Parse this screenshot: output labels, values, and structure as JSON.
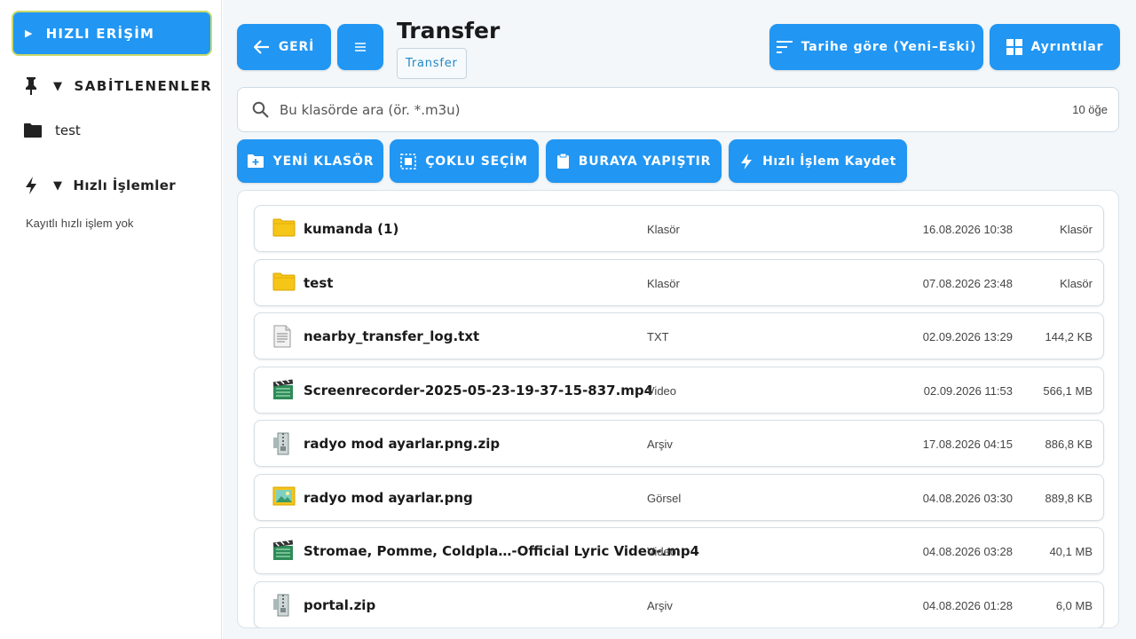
{
  "sidebar": {
    "quick_access_label": "HIZLI ERİŞİM",
    "pinned_label": "SABİTLENENLER",
    "pinned_items": [
      "test"
    ],
    "quick_ops_label": "Hızlı İşlemler",
    "quick_ops_empty": "Kayıtlı hızlı işlem yok"
  },
  "header": {
    "back_label": "GERİ",
    "title": "Transfer",
    "breadcrumb": "Transfer",
    "sort_label": "Tarihe göre (Yeni–Eski)",
    "details_label": "Ayrıntılar"
  },
  "search": {
    "placeholder": "Bu klasörde ara (ör. *.m3u)",
    "count": "10 öğe"
  },
  "actions": {
    "new_folder": "YENİ KLASÖR",
    "multi_select": "ÇOKLU SEÇİM",
    "paste_here": "BURAYA YAPIŞTIR",
    "save_quick_op": "Hızlı İşlem Kaydet"
  },
  "files": [
    {
      "icon": "folder-icon",
      "name": "kumanda (1)",
      "type": "Klasör",
      "date": "16.08.2026 10:38",
      "size": "Klasör"
    },
    {
      "icon": "folder-icon",
      "name": "test",
      "type": "Klasör",
      "date": "07.08.2026 23:48",
      "size": "Klasör"
    },
    {
      "icon": "text-file-icon",
      "name": "nearby_transfer_log.txt",
      "type": "TXT",
      "date": "02.09.2026 13:29",
      "size": "144,2 KB"
    },
    {
      "icon": "video-file-icon",
      "name": "Screenrecorder-2025-05-23-19-37-15-837.mp4",
      "type": "Video",
      "date": "02.09.2026 11:53",
      "size": "566,1 MB"
    },
    {
      "icon": "archive-file-icon",
      "name": "radyo mod ayarlar.png.zip",
      "type": "Arşiv",
      "date": "17.08.2026 04:15",
      "size": "886,8 KB"
    },
    {
      "icon": "image-file-icon",
      "name": "radyo mod ayarlar.png",
      "type": "Görsel",
      "date": "04.08.2026 03:30",
      "size": "889,8 KB"
    },
    {
      "icon": "video-file-icon",
      "name": "Stromae, Pomme, Coldpla…-Official Lyric Video-.mp4",
      "type": "Video",
      "date": "04.08.2026 03:28",
      "size": "40,1 MB"
    },
    {
      "icon": "archive-file-icon",
      "name": "portal.zip",
      "type": "Arşiv",
      "date": "04.08.2026 01:28",
      "size": "6,0 MB"
    }
  ],
  "colors": {
    "accent": "#2196f3",
    "background": "#f3f7fa",
    "highlight_border": "#c9d96a"
  }
}
